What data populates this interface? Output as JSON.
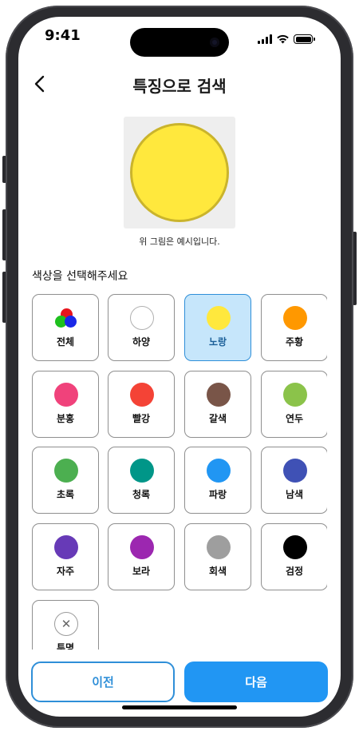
{
  "status": {
    "time": "9:41"
  },
  "header": {
    "title": "특징으로 검색"
  },
  "preview": {
    "color": "#ffe83d",
    "caption": "위 그림은 예시입니다."
  },
  "section_label": "색상을 선택해주세요",
  "colors": [
    {
      "label": "전체",
      "color": "",
      "selected": false
    },
    {
      "label": "하양",
      "color": "#ffffff",
      "selected": false
    },
    {
      "label": "노랑",
      "color": "#ffe83d",
      "selected": true
    },
    {
      "label": "주황",
      "color": "#ff9800",
      "selected": false
    },
    {
      "label": "분홍",
      "color": "#f0427b",
      "selected": false
    },
    {
      "label": "빨강",
      "color": "#f44336",
      "selected": false
    },
    {
      "label": "갈색",
      "color": "#795548",
      "selected": false
    },
    {
      "label": "연두",
      "color": "#8bc34a",
      "selected": false
    },
    {
      "label": "초록",
      "color": "#4caf50",
      "selected": false
    },
    {
      "label": "청록",
      "color": "#009688",
      "selected": false
    },
    {
      "label": "파랑",
      "color": "#2196f3",
      "selected": false
    },
    {
      "label": "남색",
      "color": "#3f51b5",
      "selected": false
    },
    {
      "label": "자주",
      "color": "#673ab7",
      "selected": false
    },
    {
      "label": "보라",
      "color": "#9c27b0",
      "selected": false
    },
    {
      "label": "회색",
      "color": "#9e9e9e",
      "selected": false
    },
    {
      "label": "검정",
      "color": "#000000",
      "selected": false
    },
    {
      "label": "투명",
      "color": "",
      "selected": false
    }
  ],
  "buttons": {
    "prev_label": "이전",
    "next_label": "다음"
  },
  "theme": {
    "accent": "#2196f3",
    "selected_bg": "#c6e6fb"
  }
}
